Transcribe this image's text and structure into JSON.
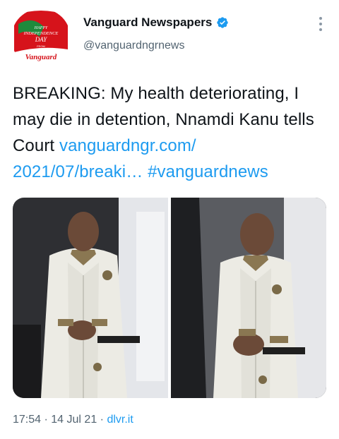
{
  "account": {
    "display_name": "Vanguard Newspapers",
    "handle": "@vanguardngrnews",
    "verified": true,
    "avatar_text": {
      "line1": "HAPPY",
      "line2": "INDEPENDENCE",
      "line3": "DAY",
      "line4": "FROM",
      "brand": "Vanguard"
    }
  },
  "tweet": {
    "text_plain": "BREAKING: My health deteriorating, I may die in detention, Nnamdi Kanu tells Court",
    "link": "vanguardngr.com/ 2021/07/breaki…",
    "hashtag": "#vanguardnews"
  },
  "media": {
    "photo_count": 2,
    "photos": [
      {
        "subject": "man in white outfit, left photo"
      },
      {
        "subject": "man in white outfit, right photo"
      }
    ]
  },
  "meta": {
    "time": "17:54",
    "date": "14 Jul 21",
    "source": "dlvr.it"
  },
  "icons": {
    "verified": "verified-badge-icon",
    "more": "more-options-icon"
  },
  "colors": {
    "link": "#1d9bf0",
    "text": "#0f1419",
    "secondary": "#536471",
    "avatar_red": "#d6131b"
  }
}
